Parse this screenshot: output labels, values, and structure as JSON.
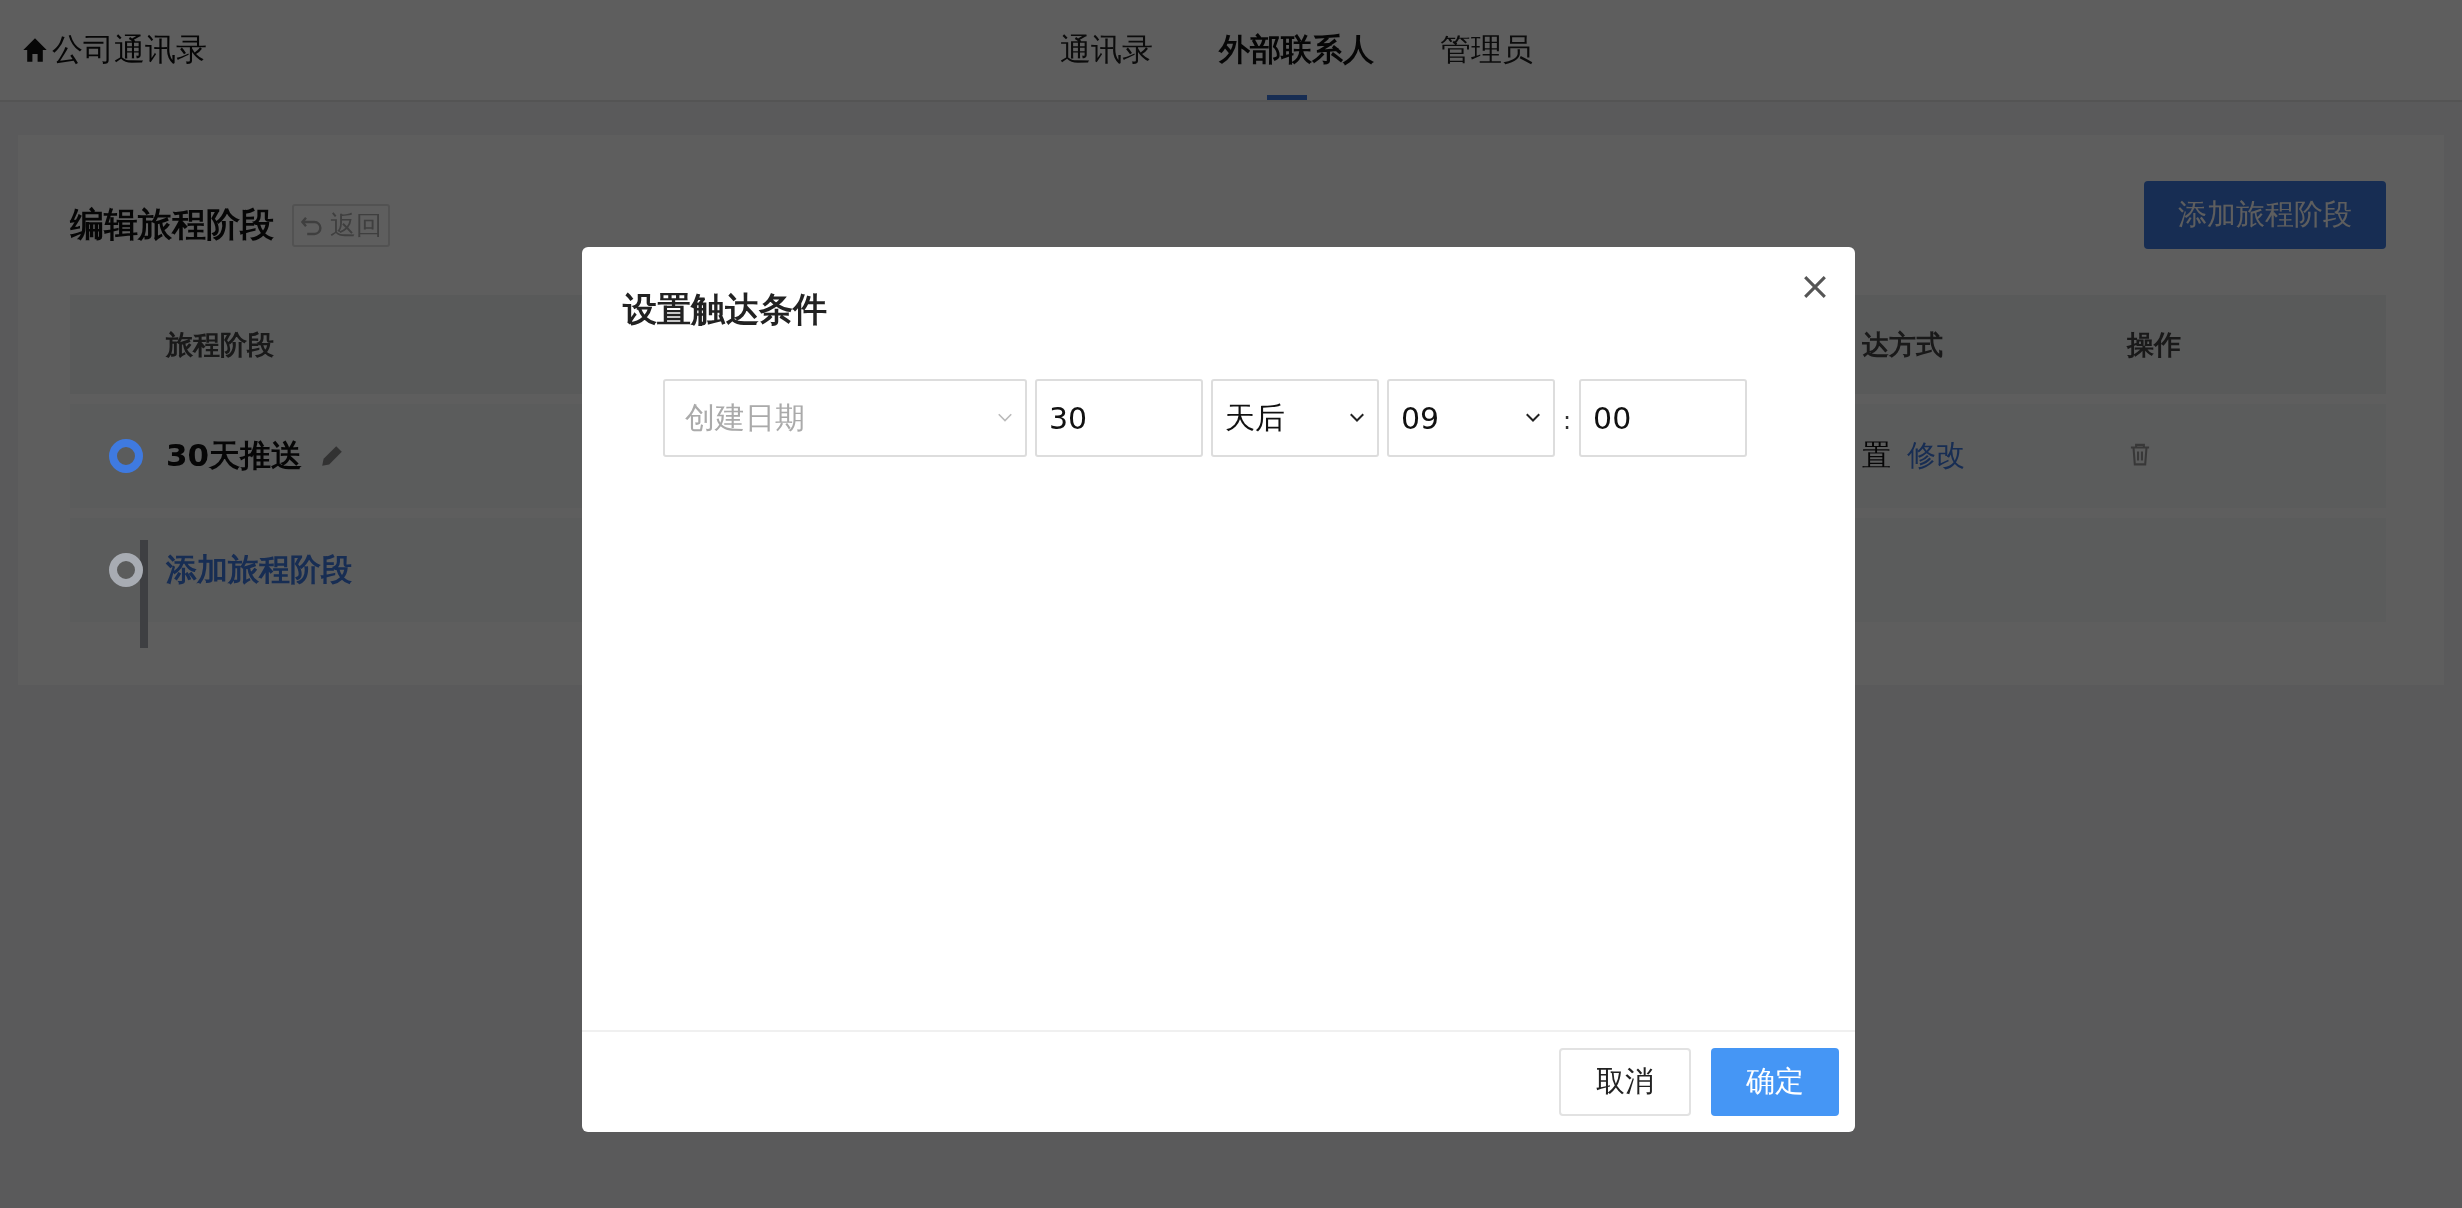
{
  "header": {
    "brand": "公司通讯录",
    "tabs": [
      {
        "label": "通讯录",
        "selected": false
      },
      {
        "label": "外部联系人",
        "selected": true
      },
      {
        "label": "管理员",
        "selected": false
      }
    ]
  },
  "page": {
    "title": "编辑旅程阶段",
    "back_button": "返回",
    "add_button": "添加旅程阶段",
    "table": {
      "columns": [
        "旅程阶段",
        "达方式",
        "操作"
      ],
      "rows": [
        {
          "stage": "30天推送",
          "method": "置",
          "action_link": "修改"
        }
      ],
      "add_row": "添加旅程阶段"
    }
  },
  "dialog": {
    "title": "设置触达条件",
    "date_field": {
      "placeholder": "创建日期"
    },
    "days": "30",
    "unit": "天后",
    "hour": "09",
    "separator": ":",
    "minute": "00",
    "buttons": [
      {
        "label": "取消",
        "kind": "secondary"
      },
      {
        "label": "确定",
        "kind": "primary"
      }
    ]
  }
}
